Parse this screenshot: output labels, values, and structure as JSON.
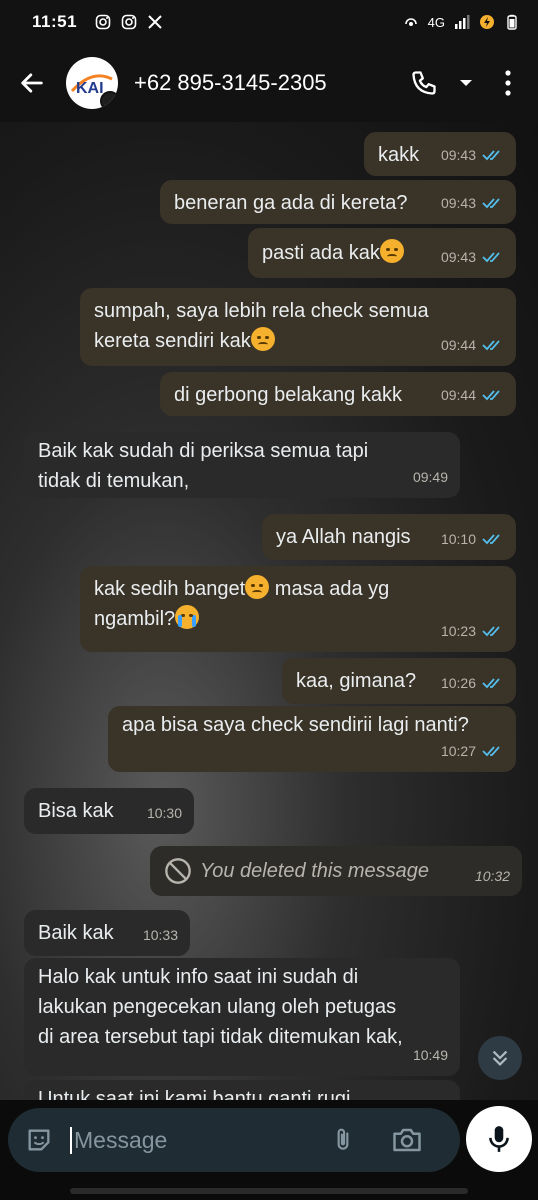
{
  "status_bar": {
    "time": "11:51",
    "network": "4G",
    "app_icons": [
      "instagram-icon",
      "instagram-icon",
      "x-icon"
    ]
  },
  "header": {
    "contact_name": "+62 895-3145-2305",
    "avatar_text": "KAI"
  },
  "messages": [
    {
      "dir": "out",
      "text": "kakk",
      "time": "09:43"
    },
    {
      "dir": "out",
      "text": "beneran ga ada di kereta?",
      "time": "09:43"
    },
    {
      "dir": "out",
      "text": "pasti ada kak",
      "emoji": "disappointed",
      "time": "09:43"
    },
    {
      "dir": "out",
      "line1": "sumpah, saya lebih rela check semua",
      "line2": "kereta sendiri kak",
      "emoji": "disappointed",
      "time": "09:44"
    },
    {
      "dir": "out",
      "text": "di gerbong belakang kakk",
      "time": "09:44"
    },
    {
      "dir": "in",
      "line1": "Baik kak sudah di periksa semua tapi",
      "line2": "tidak di temukan,",
      "time": "09:49"
    },
    {
      "dir": "out",
      "text": "ya Allah nangis",
      "time": "10:10"
    },
    {
      "dir": "out",
      "line1a": "kak sedih banget",
      "line1b": " masa ada yg",
      "line2": "ngambil?",
      "time": "10:23"
    },
    {
      "dir": "out",
      "text": "kaa, gimana?",
      "time": "10:26"
    },
    {
      "dir": "out",
      "text": "apa bisa saya check sendirii lagi nanti?",
      "time": "10:27"
    },
    {
      "dir": "in",
      "text": "Bisa kak",
      "time": "10:30"
    },
    {
      "dir": "out",
      "deleted": true,
      "text": "You deleted this message",
      "time": "10:32"
    },
    {
      "dir": "in",
      "text": "Baik kak",
      "time": "10:33"
    },
    {
      "dir": "in",
      "line1": "Halo kak untuk info saat ini sudah di",
      "line2": "lakukan pengecekan ulang oleh petugas",
      "line3": "di area tersebut tapi tidak ditemukan kak,",
      "time": "10:49"
    },
    {
      "dir": "in",
      "text": "Untuk saat ini kami bantu ganti rugi"
    }
  ],
  "composer": {
    "placeholder": "Message"
  },
  "colors": {
    "outgoing_bubble": "#3a3327",
    "incoming_bubble": "#2a2a2a",
    "read_ticks": "#53bdeb",
    "header_bg": "#121212"
  }
}
